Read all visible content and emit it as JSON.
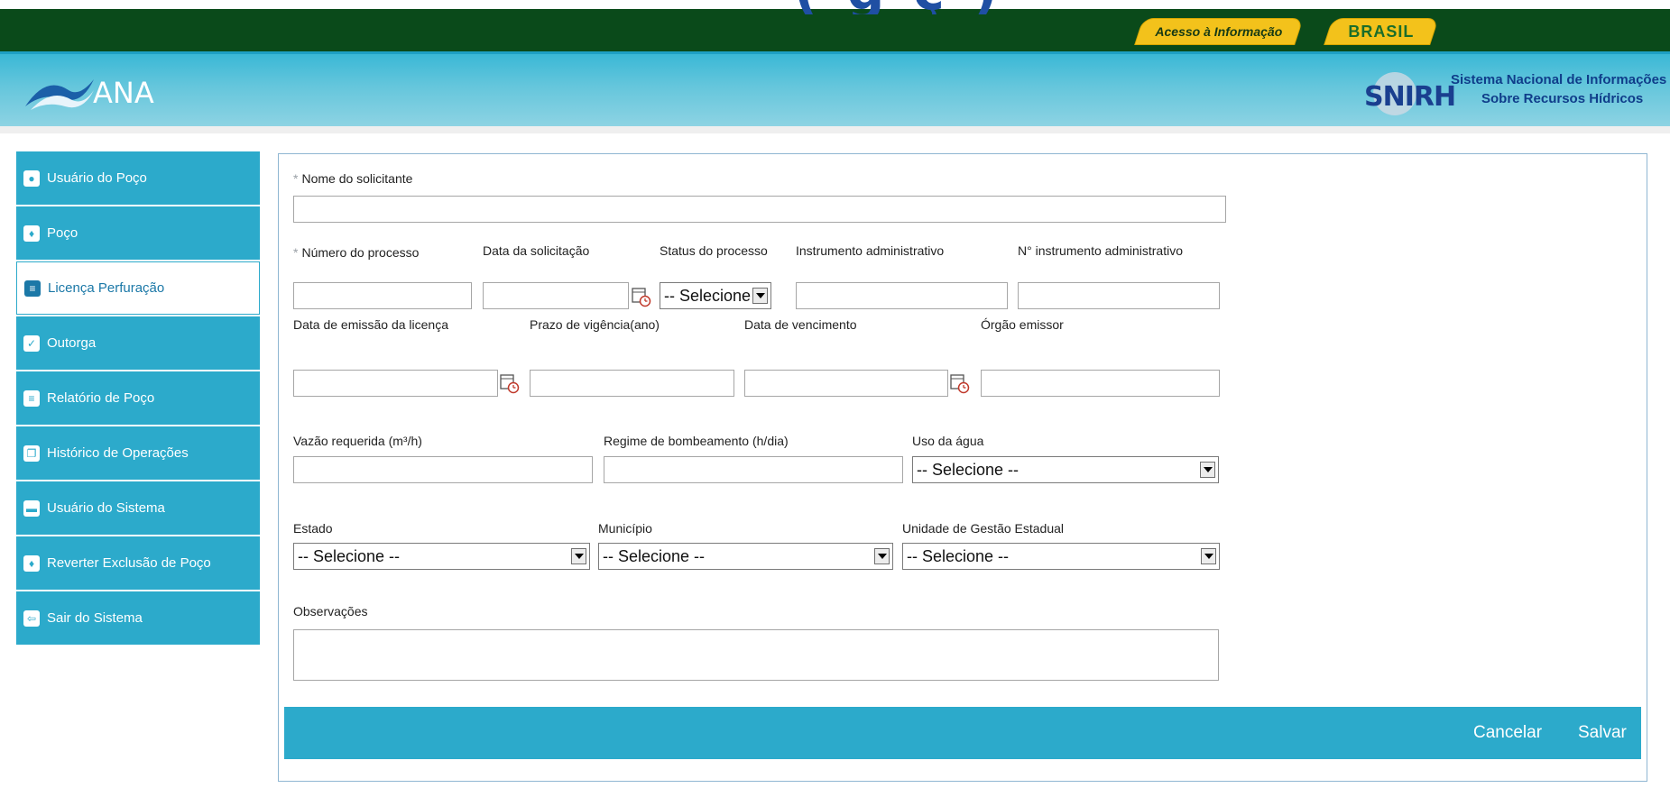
{
  "top_partial_title": "( g ç )",
  "gov_bar": {
    "access_label": "Acesso à Informação",
    "brasil_label": "BRASIL"
  },
  "header": {
    "logo_text": "ANA",
    "snirh_text": "SNIRH",
    "snirh_line1": "Sistema Nacional de Informações",
    "snirh_line2": "Sobre Recursos Hídricos"
  },
  "sidebar": {
    "items": [
      {
        "label": "Usuário do Poço",
        "icon": "user-icon"
      },
      {
        "label": "Poço",
        "icon": "drop-icon"
      },
      {
        "label": "Licença Perfuração",
        "icon": "document-icon"
      },
      {
        "label": "Outorga",
        "icon": "checklist-icon"
      },
      {
        "label": "Relatório de Poço",
        "icon": "report-icon"
      },
      {
        "label": "Histórico de Operações",
        "icon": "history-icon"
      },
      {
        "label": "Usuário do Sistema",
        "icon": "monitor-icon"
      },
      {
        "label": "Reverter Exclusão de Poço",
        "icon": "drop-icon"
      },
      {
        "label": "Sair do Sistema",
        "icon": "exit-icon"
      }
    ],
    "active_index": 2
  },
  "form": {
    "nome_solicitante": {
      "label": "Nome do solicitante",
      "value": ""
    },
    "numero_processo": {
      "label": "Número do processo",
      "value": ""
    },
    "data_solicitacao": {
      "label": "Data da solicitação",
      "value": ""
    },
    "status_processo": {
      "label": "Status do processo",
      "value": "-- Selecione --"
    },
    "instrumento_admin": {
      "label": "Instrumento administrativo",
      "value": ""
    },
    "n_instrumento_admin": {
      "label": "N° instrumento administrativo",
      "value": ""
    },
    "data_emissao": {
      "label": "Data de emissão da licença",
      "value": ""
    },
    "prazo_vigencia": {
      "label": "Prazo de vigência(ano)",
      "value": ""
    },
    "data_vencimento": {
      "label": "Data de vencimento",
      "value": ""
    },
    "orgao_emissor": {
      "label": "Órgão emissor",
      "value": ""
    },
    "vazao_requerida": {
      "label": "Vazão requerida (m³/h)",
      "value": ""
    },
    "regime_bombeamento": {
      "label": "Regime de bombeamento (h/dia)",
      "value": ""
    },
    "uso_agua": {
      "label": "Uso da água",
      "value": "-- Selecione --"
    },
    "estado": {
      "label": "Estado",
      "value": "-- Selecione --"
    },
    "municipio": {
      "label": "Município",
      "value": "-- Selecione --"
    },
    "unidade_gestao": {
      "label": "Unidade de Gestão Estadual",
      "value": "-- Selecione --"
    },
    "observacoes": {
      "label": "Observações",
      "value": ""
    }
  },
  "footer": {
    "cancel_label": "Cancelar",
    "save_label": "Salvar"
  },
  "colors": {
    "gov_green": "#0a4a1a",
    "gov_yellow": "#f3c21b",
    "accent": "#2caacb",
    "header_light": "#8dd3e3"
  }
}
